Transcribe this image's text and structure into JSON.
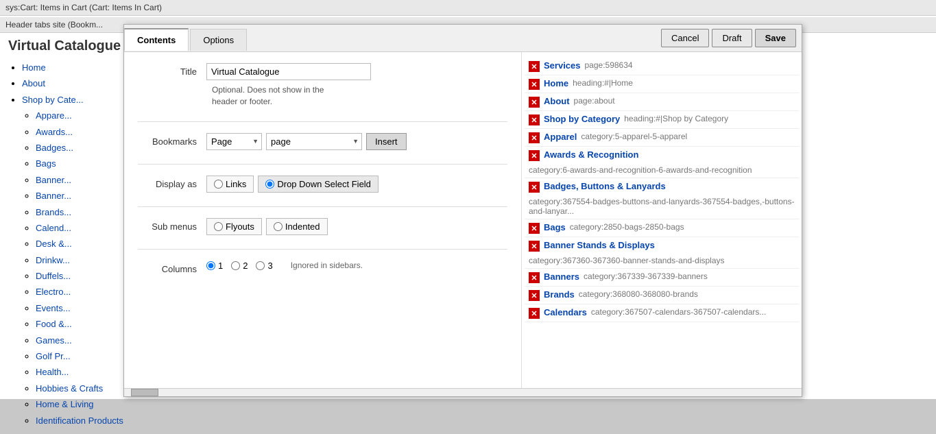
{
  "topbar": {
    "text": "sys:Cart: Items in Cart (Cart: Items In Cart)"
  },
  "topbar2": {
    "text": "Header tabs site (Bookm..."
  },
  "background": {
    "title": "Virtual Catalogue",
    "nav": {
      "items": [
        {
          "label": "Home"
        },
        {
          "label": "About"
        },
        {
          "label": "Shop by Cate...",
          "children": [
            "Appare...",
            "Awards...",
            "Badges...",
            "Bags",
            "Banner...",
            "Banner...",
            "Brands...",
            "Calend...",
            "Desk &...",
            "Drinkw...",
            "Duffels...",
            "Electro...",
            "Events...",
            "Food &...",
            "Games...",
            "Golf Pr...",
            "Health...",
            "Hobbies & Crafts",
            "Home & Living",
            "Identification Products"
          ]
        }
      ]
    }
  },
  "modal": {
    "tabs": [
      {
        "label": "Contents",
        "active": true
      },
      {
        "label": "Options",
        "active": false
      }
    ],
    "buttons": {
      "cancel": "Cancel",
      "draft": "Draft",
      "save": "Save"
    },
    "form": {
      "title_label": "Title",
      "title_value": "Virtual Catalogue",
      "title_note": "Optional. Does not show in the header or footer.",
      "bookmarks_label": "Bookmarks",
      "page_select": "Page",
      "page_select2": "page",
      "insert_button": "Insert",
      "display_as_label": "Display as",
      "display_links": "Links",
      "display_dropdown": "Drop Down Select Field",
      "submenus_label": "Sub menus",
      "flyouts": "Flyouts",
      "indented": "Indented",
      "columns_label": "Columns",
      "col1": "1",
      "col2": "2",
      "col3": "3",
      "columns_note": "Ignored in sidebars."
    },
    "bookmarks": [
      {
        "name": "Services",
        "path": "page:598634"
      },
      {
        "name": "Home",
        "path": "heading:#|Home"
      },
      {
        "name": "About",
        "path": "page:about"
      },
      {
        "name": "Shop by Category",
        "path": "heading:#|Shop by Category"
      },
      {
        "name": "Apparel",
        "path": "category:5-apparel-5-apparel"
      },
      {
        "name": "Awards & Recognition",
        "path": "category:6-awards-and-recognition-6-awards-and-recognition"
      },
      {
        "name": "Badges, Buttons & Lanyards",
        "path": "category:367554-badges-buttons-and-lanyards-367554-badges,-buttons-and-lanyar..."
      },
      {
        "name": "Bags",
        "path": "category:2850-bags-2850-bags"
      },
      {
        "name": "Banner Stands & Displays",
        "path": "category:367360-367360-banner-stands-and-displays"
      },
      {
        "name": "Banners",
        "path": "category:367339-367339-banners"
      },
      {
        "name": "Brands",
        "path": "category:368080-368080-brands"
      },
      {
        "name": "Calendars",
        "path": "category:367507-calendars-367507-calendars..."
      }
    ]
  }
}
